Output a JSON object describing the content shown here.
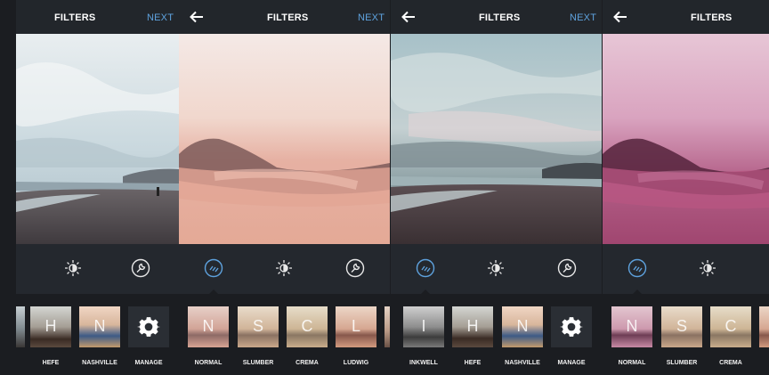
{
  "screens": [
    {
      "title": "FILTERS",
      "next_label": "NEXT",
      "has_back": false,
      "tools": [
        "brightness-icon",
        "wrench-icon"
      ],
      "filters": [
        {
          "letter": "H",
          "label": "HEFE"
        },
        {
          "letter": "N",
          "label": "NASHVILLE"
        },
        {
          "letter": "",
          "label": "MANAGE"
        }
      ]
    },
    {
      "title": "FILTERS",
      "next_label": "NEXT",
      "has_back": true,
      "active_tool": "filter-icon",
      "tools": [
        "filter-icon",
        "brightness-icon",
        "wrench-icon"
      ],
      "filters": [
        {
          "letter": "N",
          "label": "NORMAL"
        },
        {
          "letter": "S",
          "label": "SLUMBER"
        },
        {
          "letter": "C",
          "label": "CREMA"
        },
        {
          "letter": "L",
          "label": "LUDWIG"
        }
      ]
    },
    {
      "title": "FILTERS",
      "next_label": "NEXT",
      "has_back": true,
      "active_tool": "filter-icon",
      "tools": [
        "filter-icon",
        "brightness-icon",
        "wrench-icon"
      ],
      "filters": [
        {
          "letter": "I",
          "label": "INKWELL"
        },
        {
          "letter": "H",
          "label": "HEFE"
        },
        {
          "letter": "N",
          "label": "NASHVILLE"
        },
        {
          "letter": "",
          "label": "MANAGE"
        }
      ]
    },
    {
      "title": "FILTERS",
      "has_back": true,
      "active_tool": "filter-icon",
      "tools": [
        "filter-icon",
        "brightness-icon"
      ],
      "filters": [
        {
          "letter": "N",
          "label": "NORMAL"
        },
        {
          "letter": "S",
          "label": "SLUMBER"
        },
        {
          "letter": "C",
          "label": "CREMA"
        }
      ]
    }
  ],
  "colors": {
    "accent": "#5ea2de",
    "background": "#1b1d21",
    "toolbar": "#24282e"
  }
}
